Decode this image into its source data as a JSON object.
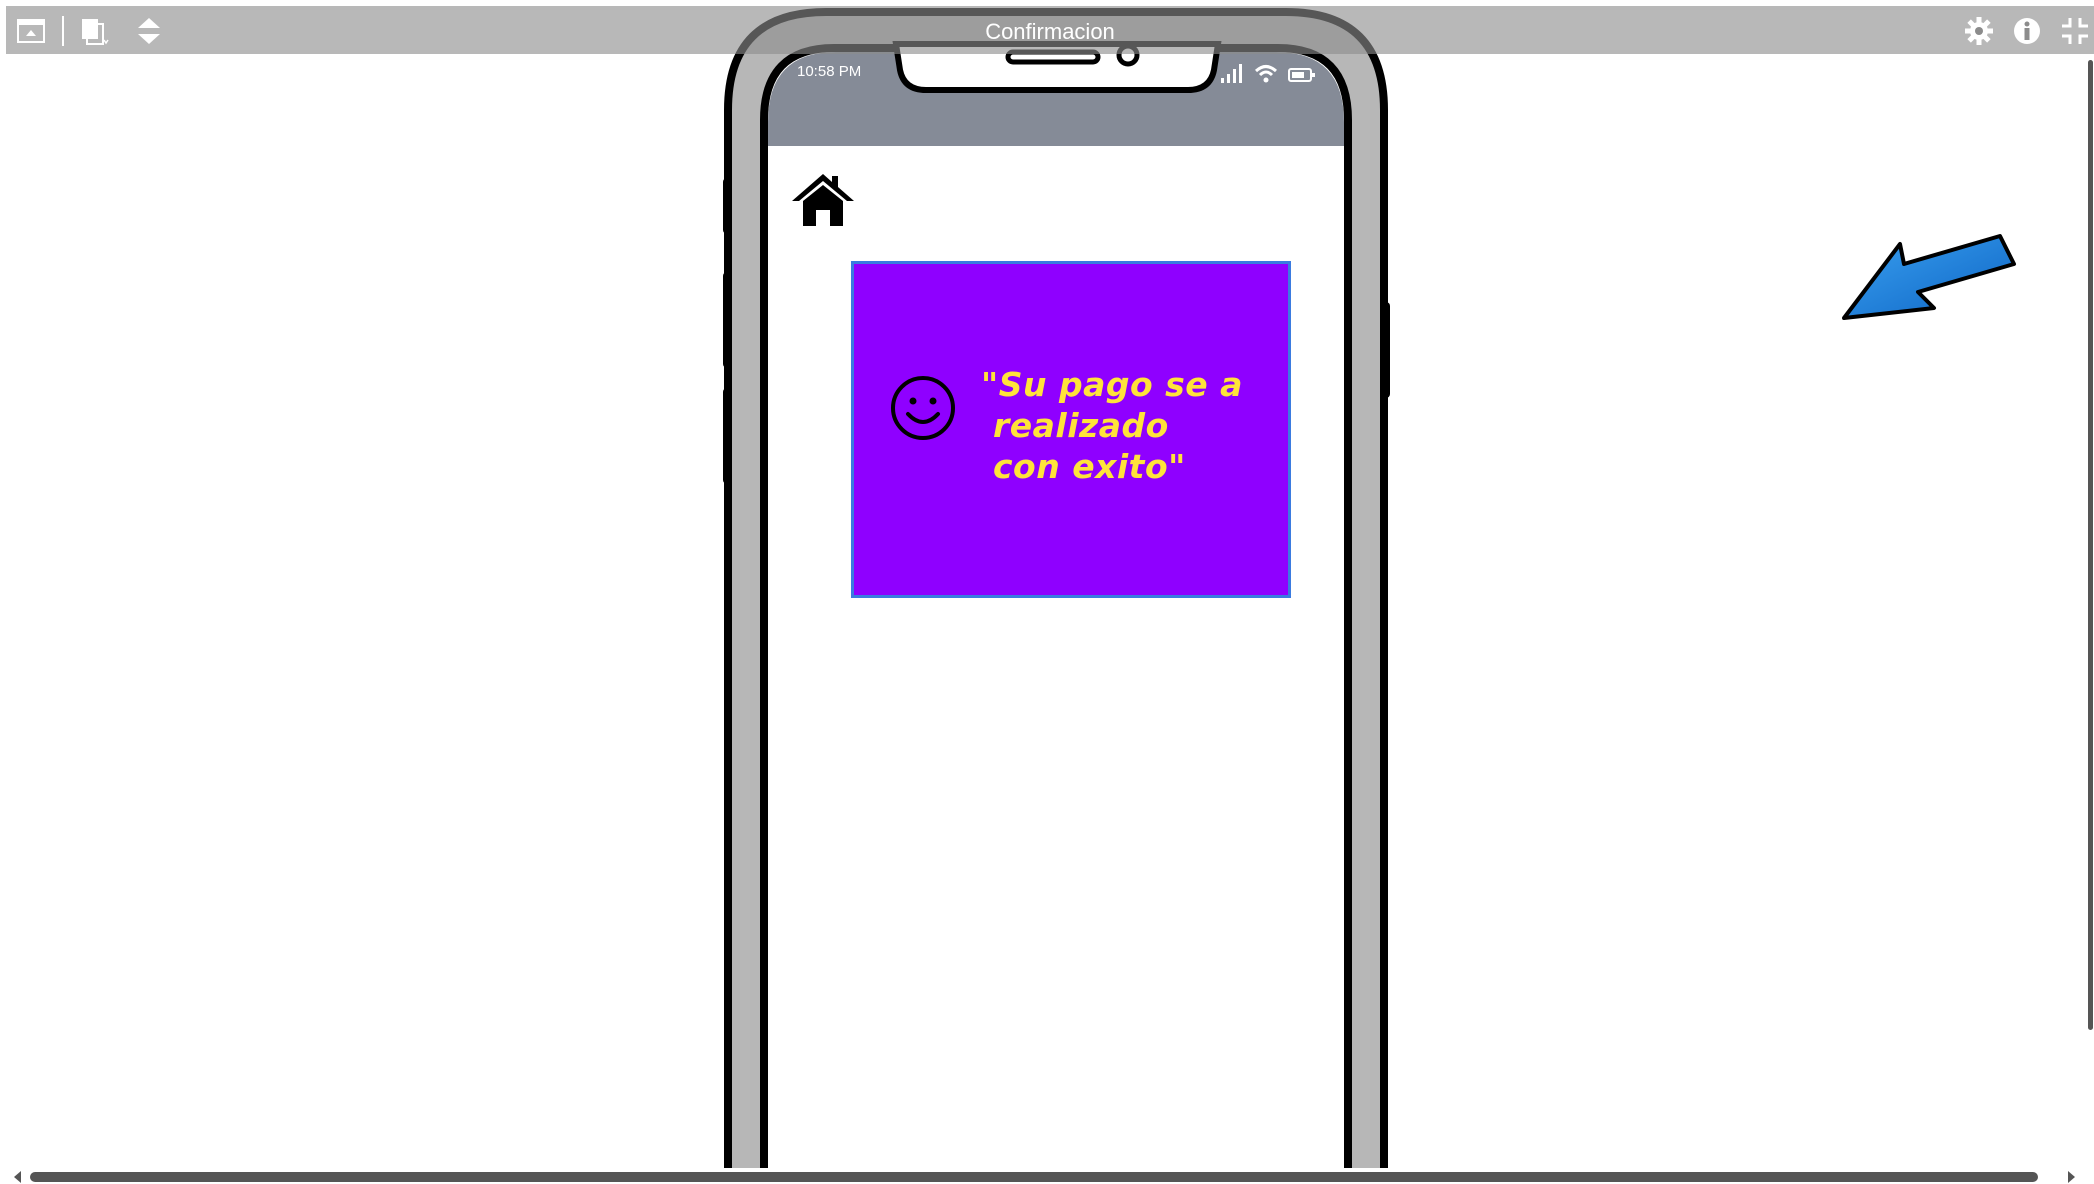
{
  "toolbar": {
    "title": "Confirmacion",
    "left_icons": [
      "collapse-panel-icon",
      "pages-icon",
      "sort-arrows-icon"
    ],
    "right_icons": [
      "gear-icon",
      "info-icon",
      "exit-fullscreen-icon"
    ]
  },
  "phone": {
    "status_time": "10:58 PM",
    "status_icons": [
      "signal-icon",
      "wifi-icon",
      "battery-icon"
    ],
    "header_color": "#858b97"
  },
  "message": {
    "text": "\"Su pago se a\n realizado\n con exito\"",
    "background": "#8f00ff",
    "text_color": "#ffe33a",
    "icon": "smiley-icon"
  },
  "annotation": {
    "icon": "blue-arrow-icon",
    "color": "#1a7fd6"
  }
}
